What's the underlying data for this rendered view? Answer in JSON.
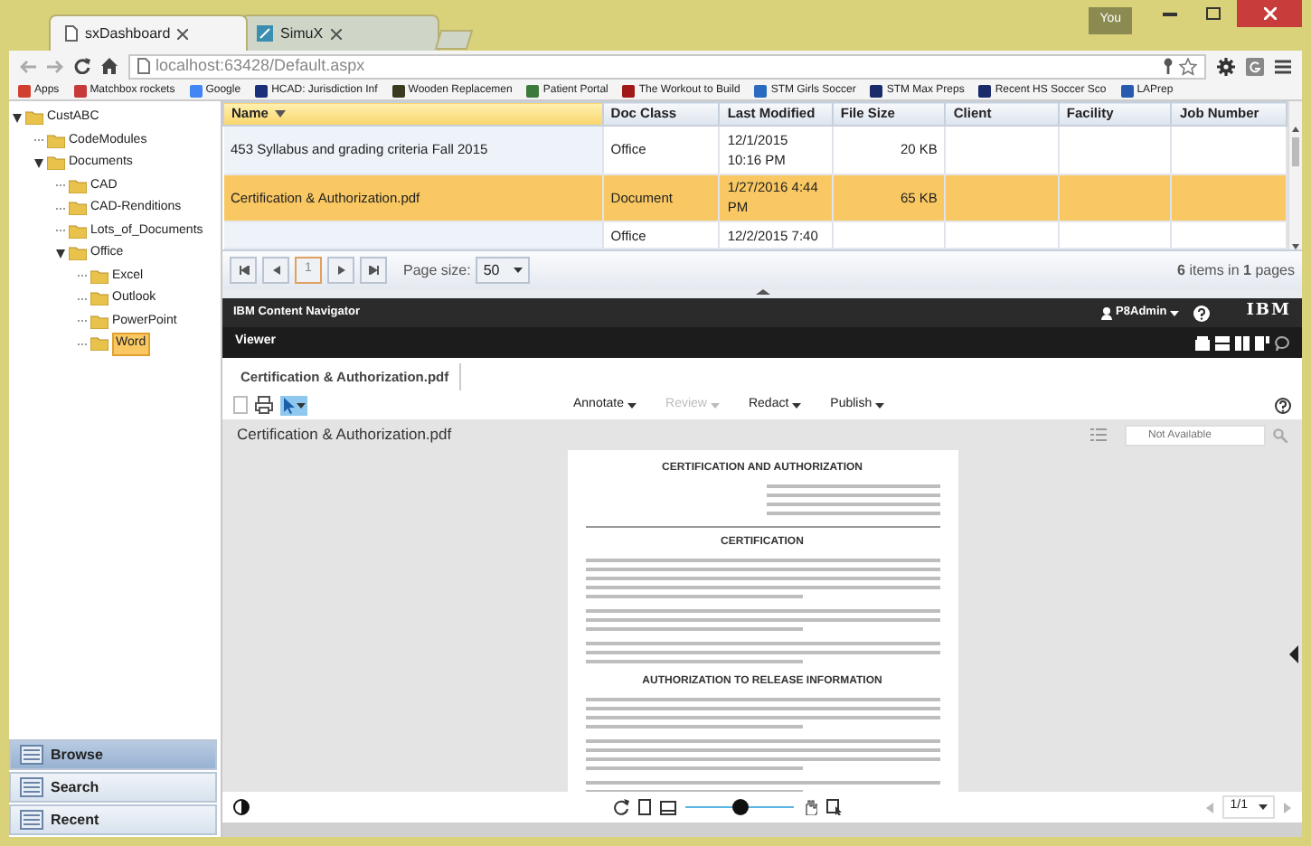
{
  "browser": {
    "tabs": [
      {
        "title": "sxDashboard",
        "selected": true
      },
      {
        "title": "SimuX",
        "selected": false
      }
    ],
    "user_badge": "You",
    "address": {
      "host": "localhost",
      "rest": ":63428/Default.aspx"
    },
    "bookmarks": [
      {
        "label": "Apps",
        "color": "#d04030"
      },
      {
        "label": "Matchbox rockets",
        "color": "#c83a3a"
      },
      {
        "label": "Google",
        "color": "#4285f4"
      },
      {
        "label": "HCAD: Jurisdiction Inf",
        "color": "#1c2f7a"
      },
      {
        "label": "Wooden Replacemen",
        "color": "#3a3a20"
      },
      {
        "label": "Patient Portal",
        "color": "#3c7a3c"
      },
      {
        "label": "The Workout to Build",
        "color": "#a01818"
      },
      {
        "label": "STM Girls Soccer",
        "color": "#2a6ac0"
      },
      {
        "label": "STM Max Preps",
        "color": "#1a2a6a"
      },
      {
        "label": "Recent HS Soccer Sco",
        "color": "#1a2a6a"
      },
      {
        "label": "LAPrep",
        "color": "#2a5ab0"
      }
    ]
  },
  "tree": {
    "label": "CustABC",
    "expanded": true,
    "selected": false,
    "children": [
      {
        "label": "CodeModules",
        "selected": false
      },
      {
        "label": "Documents",
        "expanded": true,
        "selected": false,
        "children": [
          {
            "label": "CAD",
            "selected": false
          },
          {
            "label": "CAD-Renditions",
            "selected": false
          },
          {
            "label": "Lots_of_Documents",
            "selected": false
          },
          {
            "label": "Office",
            "expanded": true,
            "selected": false,
            "children": [
              {
                "label": "Excel",
                "selected": false
              },
              {
                "label": "Outlook",
                "selected": false
              },
              {
                "label": "PowerPoint",
                "selected": false
              },
              {
                "label": "Word",
                "selected": true
              }
            ]
          }
        ]
      }
    ]
  },
  "nav_panels": [
    {
      "label": "Browse",
      "selected": true
    },
    {
      "label": "Search",
      "selected": false
    },
    {
      "label": "Recent",
      "selected": false
    }
  ],
  "grid": {
    "columns": [
      {
        "label": "Name",
        "sorted": true
      },
      {
        "label": "Doc Class",
        "sorted": false
      },
      {
        "label": "Last Modified",
        "sorted": false
      },
      {
        "label": "File Size",
        "sorted": false
      },
      {
        "label": "Client",
        "sorted": false
      },
      {
        "label": "Facility",
        "sorted": false
      },
      {
        "label": "Job Number",
        "sorted": false
      }
    ],
    "rows": [
      {
        "name": "453 Syllabus and grading criteria Fall 2015",
        "doc_class": "Office",
        "last_modified": "12/1/2015 10:16 PM",
        "file_size": "20 KB",
        "selected": false
      },
      {
        "name": "Certification & Authorization.pdf",
        "doc_class": "Document",
        "last_modified": "1/27/2016 4:44 PM",
        "file_size": "65 KB",
        "selected": true
      },
      {
        "doc_class": "Office",
        "last_modified": "12/2/2015 7:40",
        "selected": false
      }
    ]
  },
  "pager": {
    "page": "1",
    "page_size_label": "Page size:",
    "page_size": "50",
    "summary": "**6** items in **1** pages"
  },
  "navigator": {
    "app_title": "IBM Content Navigator",
    "user": "P8Admin",
    "brand": "IBM",
    "viewer_title": "Viewer",
    "doc_tab": "Certification & Authorization.pdf",
    "pointer_tool": {
      "selected": true
    },
    "menus": [
      {
        "label": "Annotate",
        "disabled": false
      },
      {
        "label": "Review",
        "disabled": true
      },
      {
        "label": "Redact",
        "disabled": false
      },
      {
        "label": "Publish",
        "disabled": false
      }
    ],
    "doc_title": "Certification & Authorization.pdf",
    "search": {
      "placeholder": "Not Available"
    },
    "document": {
      "title": "CERTIFICATION AND AUTHORIZATION",
      "sections": [
        "CERTIFICATION",
        "AUTHORIZATION TO RELEASE INFORMATION"
      ]
    },
    "zoom": {
      "level": 0.5
    },
    "page_indicator": "1/1"
  }
}
